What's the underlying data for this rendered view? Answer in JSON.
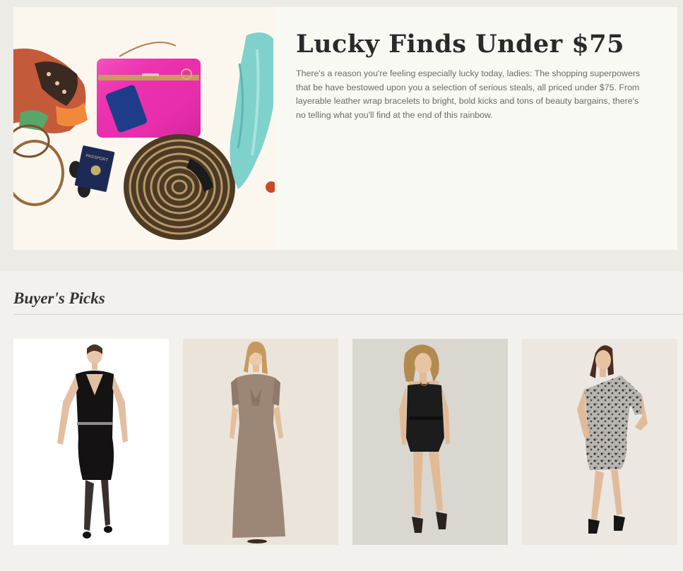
{
  "hero": {
    "title": "Lucky Finds Under $75",
    "body": "There's a reason you're feeling especially lucky today, ladies: The shopping superpowers that be have bestowed upon you a selection of serious steals, all priced under $75. From layerable leather wrap bracelets to bright, bold kicks and tons of beauty bargains, there's no telling what you'll find at the end of this rainbow.",
    "passport_label": "PASSPORT"
  },
  "picks": {
    "heading": "Buyer's Picks",
    "products": [
      {
        "icon": "black-velvet-dress-photo",
        "bg": "#ffffff"
      },
      {
        "icon": "taupe-maxi-dress-photo",
        "bg": "#ebe4da"
      },
      {
        "icon": "black-strapless-romper-photo",
        "bg": "#dad7d0"
      },
      {
        "icon": "leopard-one-shoulder-dress-photo",
        "bg": "#ece7e0"
      }
    ]
  },
  "colors": {
    "page_bg": "#ecebe6",
    "hero_bg": "#f9f9f3",
    "picks_bg": "#f2f1ed",
    "title": "#2a2a2a",
    "body_text": "#6a6a6a"
  }
}
